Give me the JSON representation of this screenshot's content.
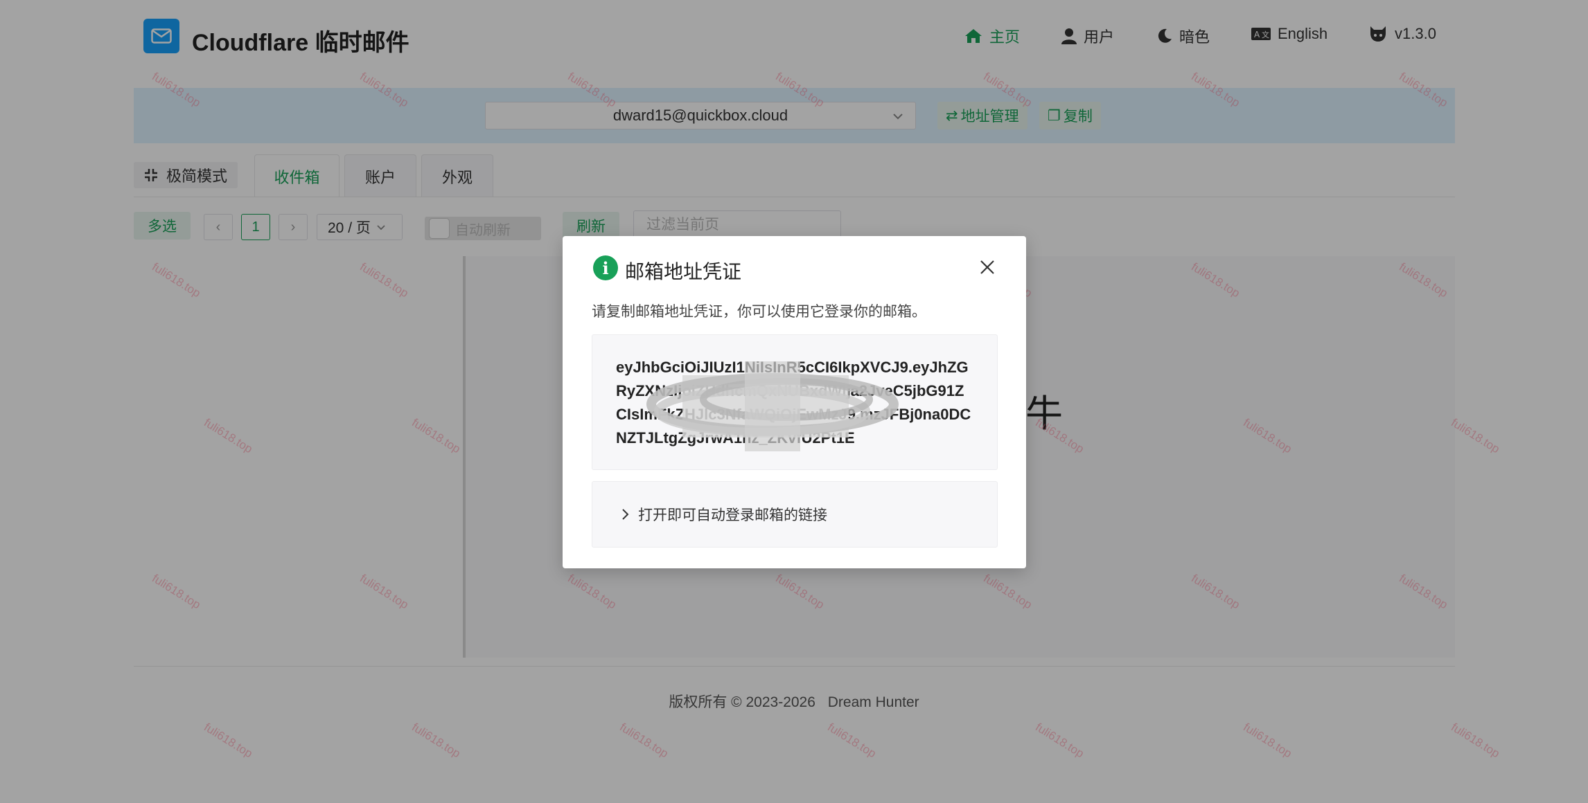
{
  "header": {
    "app_title": "Cloudflare 临时邮件",
    "nav": {
      "home": "主页",
      "user": "用户",
      "dark": "暗色",
      "language": "English",
      "version": "v1.3.0"
    }
  },
  "address_bar": {
    "current_address": "dward15@quickbox.cloud",
    "manage_label": "地址管理",
    "copy_label": "复制"
  },
  "tabs": {
    "minimal_mode": "极简模式",
    "items": [
      "收件箱",
      "账户",
      "外观"
    ],
    "active": "收件箱"
  },
  "toolbar": {
    "multi_select": "多选",
    "current_page": "1",
    "page_size": "20 / 页",
    "auto_refresh": "自动刷新",
    "refresh": "刷新",
    "filter_placeholder": "过滤当前页"
  },
  "background": {
    "fragment_text": "牛"
  },
  "footer": {
    "copyright": "版权所有 © 2023-2026",
    "author": "Dream Hunter"
  },
  "watermark": {
    "text": "fuli618.top"
  },
  "modal": {
    "title": "邮箱地址凭证",
    "description": "请复制邮箱地址凭证，你可以使用它登录你的邮箱。",
    "token": "eyJhbGciOiJIUzI1NiIsInR5cCI6IkpXVCJ9.eyJhZGRyZXNzIjoiZHdhcmQxNUBxdWlja2JveC5jbG91ZCIsImFkZHJlc3NfaWQiOjEwMzJ9.mzJFBj0na0DCNZTJLtgZgJrwA1hz_ZKvfU2Pt1E",
    "auto_login_link_label": "打开即可自动登录邮箱的链接"
  },
  "colors": {
    "accent": "#18a058",
    "brand_blue": "#18a0fb",
    "address_bar_bg": "#dff3ff",
    "watermark": "#ff6f8a"
  }
}
